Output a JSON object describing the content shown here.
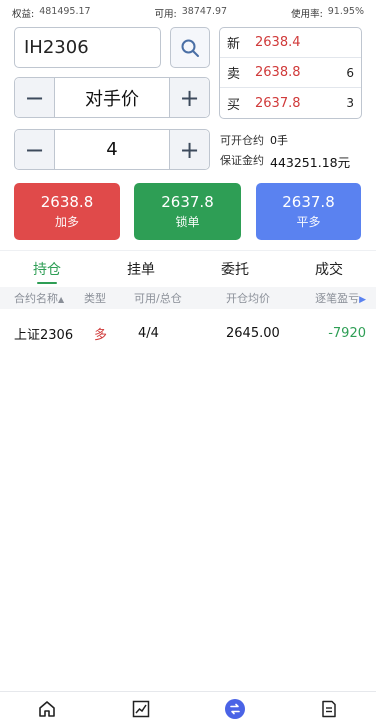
{
  "stats": {
    "equity_label": "权益:",
    "equity_value": "481495.17",
    "available_label": "可用:",
    "available_value": "38747.97",
    "usage_label": "使用率:",
    "usage_value": "91.95%"
  },
  "order": {
    "symbol": "IH2306",
    "price_type": "对手价",
    "quantity": "4",
    "max_open_label": "可开仓约",
    "max_open_value": "0手",
    "margin_label": "保证金约",
    "margin_value": "443251.18元"
  },
  "quote": {
    "last_label": "新",
    "last_price": "2638.4",
    "ask_label": "卖",
    "ask_price": "2638.8",
    "ask_vol": "6",
    "bid_label": "买",
    "bid_price": "2637.8",
    "bid_vol": "3"
  },
  "buttons": {
    "buy_open_price": "2638.8",
    "buy_open_label": "加多",
    "lock_price": "2637.8",
    "lock_label": "锁单",
    "close_long_price": "2637.8",
    "close_long_label": "平多"
  },
  "tabs": [
    "持仓",
    "挂单",
    "委托",
    "成交"
  ],
  "positions": {
    "headers": [
      "合约名称",
      "类型",
      "可用/总仓",
      "开仓均价",
      "逐笔盈亏"
    ],
    "rows": [
      {
        "name": "上证2306",
        "type": "多",
        "avail_total": "4/4",
        "avg_price": "2645.00",
        "pnl": "-7920"
      }
    ]
  },
  "colors": {
    "red": "#e04a4a",
    "green": "#2e9e55",
    "blue": "#5a82f0"
  },
  "nav": [
    "home-icon",
    "chart-icon",
    "trade-icon",
    "orders-icon"
  ]
}
